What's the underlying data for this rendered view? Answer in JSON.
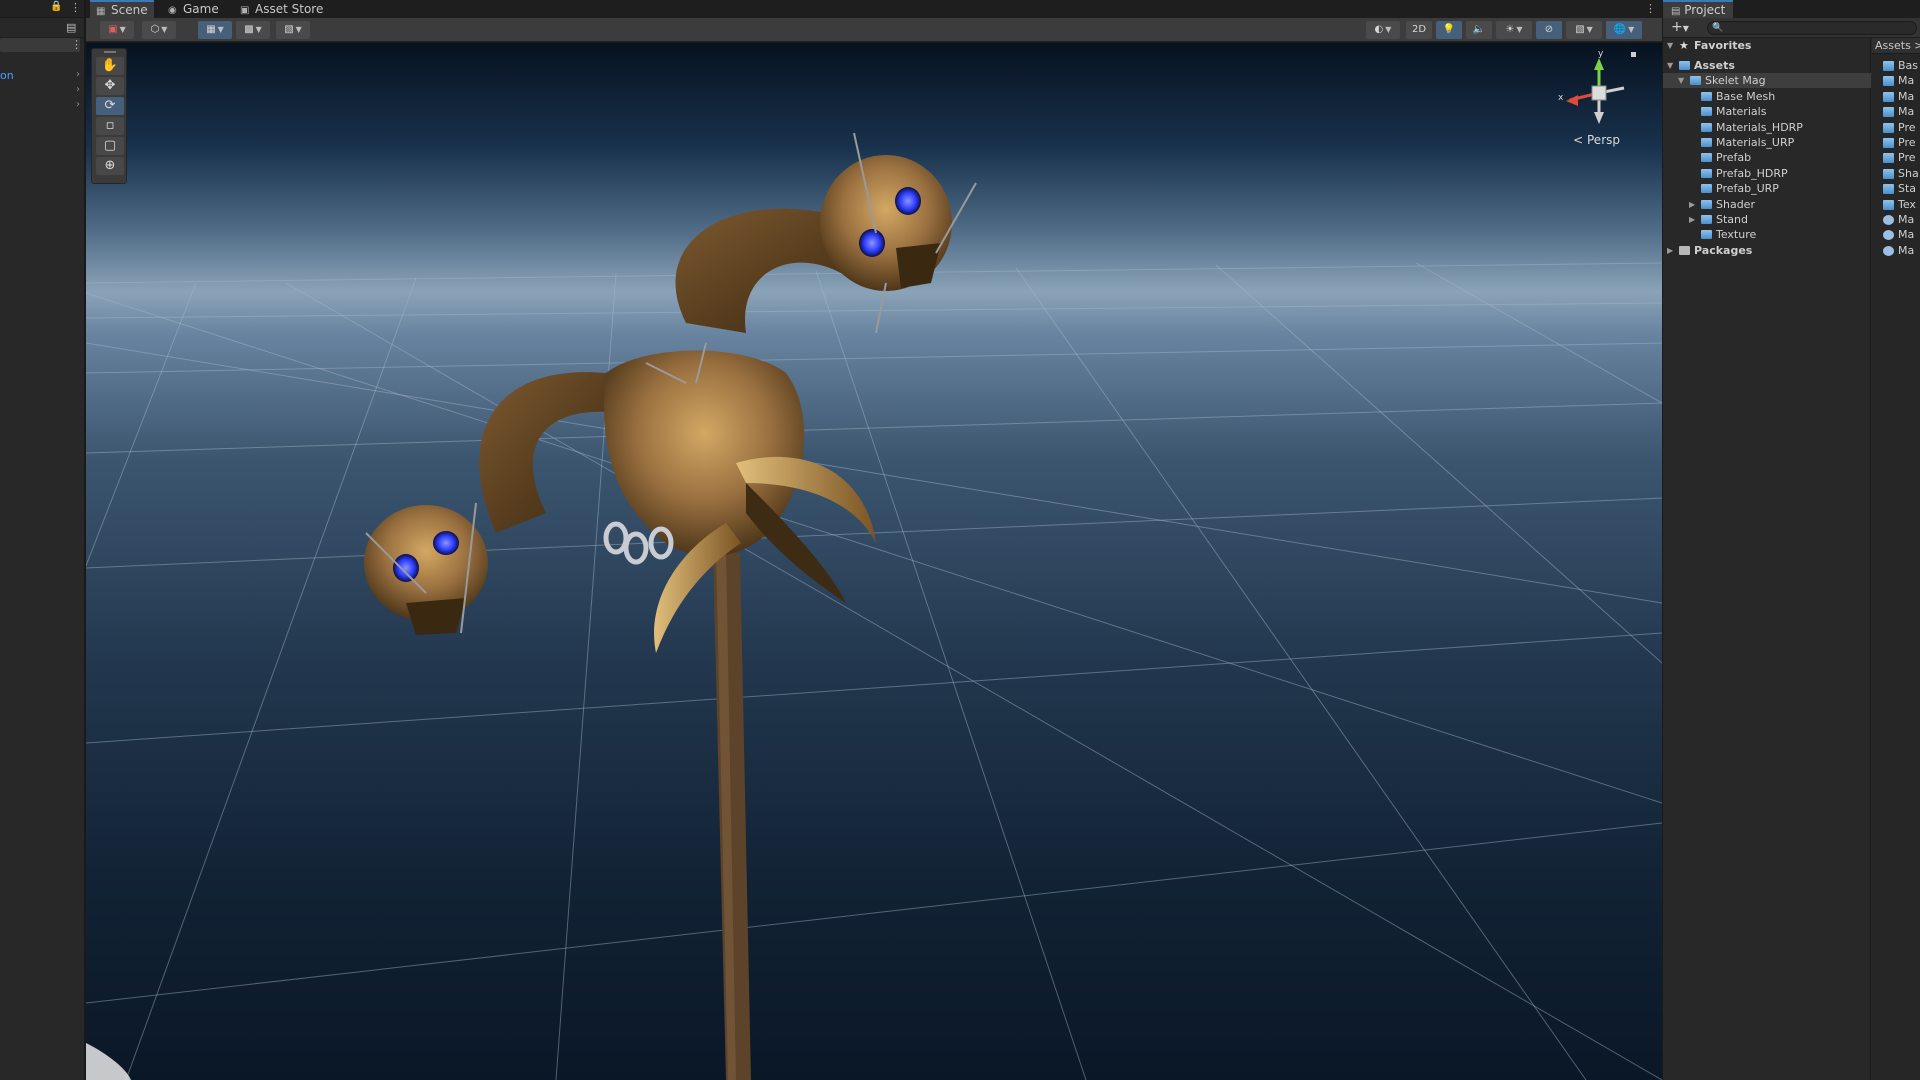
{
  "hierarchy": {
    "items": [
      {
        "label": "on"
      },
      {
        "label": ""
      },
      {
        "label": ""
      }
    ]
  },
  "scene": {
    "tabs": [
      {
        "label": "Scene",
        "icon": "grid-icon"
      },
      {
        "label": "Game",
        "icon": "gamepad-icon"
      },
      {
        "label": "Asset Store",
        "icon": "bag-icon"
      }
    ],
    "toolbar": {
      "mode_2d_label": "2D"
    },
    "perspective_label": "Persp",
    "gizmo": {
      "x_label": "x",
      "y_label": "y"
    },
    "tools": [
      "hand-tool",
      "move-tool",
      "rotate-tool",
      "scale-tool",
      "rect-tool",
      "transform-tool"
    ],
    "active_tool": "rotate-tool"
  },
  "project": {
    "tab_label": "Project",
    "add_label": "+",
    "tree": [
      {
        "label": "Favorites",
        "kind": "favorites",
        "bold": true
      },
      {
        "label": "Assets",
        "kind": "root",
        "bold": true
      },
      {
        "label": "Skelet Mag",
        "kind": "folder",
        "selected": true
      },
      {
        "label": "Base Mesh",
        "kind": "folder"
      },
      {
        "label": "Materials",
        "kind": "folder"
      },
      {
        "label": "Materials_HDRP",
        "kind": "folder"
      },
      {
        "label": "Materials_URP",
        "kind": "folder"
      },
      {
        "label": "Prefab",
        "kind": "folder"
      },
      {
        "label": "Prefab_HDRP",
        "kind": "folder"
      },
      {
        "label": "Prefab_URP",
        "kind": "folder"
      },
      {
        "label": "Shader",
        "kind": "folder",
        "collapsed": true
      },
      {
        "label": "Stand",
        "kind": "folder",
        "collapsed": true
      },
      {
        "label": "Texture",
        "kind": "folder"
      },
      {
        "label": "Packages",
        "kind": "root",
        "bold": true
      }
    ],
    "grid_header": "Assets >",
    "grid_items": [
      {
        "label": "Bas",
        "kind": "folder"
      },
      {
        "label": "Ma",
        "kind": "folder"
      },
      {
        "label": "Ma",
        "kind": "folder"
      },
      {
        "label": "Ma",
        "kind": "folder"
      },
      {
        "label": "Pre",
        "kind": "folder"
      },
      {
        "label": "Pre",
        "kind": "folder"
      },
      {
        "label": "Pre",
        "kind": "folder"
      },
      {
        "label": "Sha",
        "kind": "folder"
      },
      {
        "label": "Sta",
        "kind": "folder"
      },
      {
        "label": "Tex",
        "kind": "folder"
      },
      {
        "label": "Ma",
        "kind": "prefab"
      },
      {
        "label": "Ma",
        "kind": "prefab"
      },
      {
        "label": "Ma",
        "kind": "prefab"
      }
    ]
  },
  "colors": {
    "accent": "#3a79bb",
    "skull_eye_glow": "#2d3dff",
    "bone": "#a07a46"
  }
}
